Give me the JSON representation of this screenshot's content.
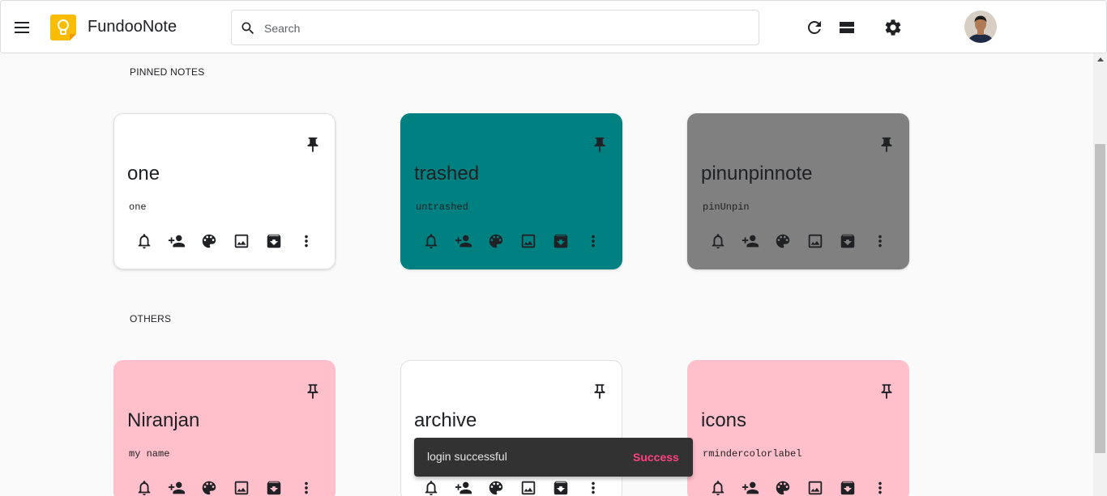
{
  "app": {
    "title": "FundooNote"
  },
  "search": {
    "placeholder": "Search"
  },
  "toolbar": {
    "refresh_icon": "refresh-icon",
    "view_icon": "list-view-icon",
    "settings_icon": "gear-icon"
  },
  "sections": {
    "pinned": "PINNED NOTES",
    "others": "OTHERS"
  },
  "colors": {
    "teal": "#008080",
    "gray": "#808080",
    "pink": "#ffc0cb",
    "white": "#ffffff",
    "accent": "#ff4081"
  },
  "notes": [
    {
      "title": "one",
      "body": "one",
      "color": "#ffffff"
    },
    {
      "title": "trashed",
      "body": "untrashed",
      "color": "#008080"
    },
    {
      "title": "pinunpinnote",
      "body": "pinUnpin",
      "color": "#808080"
    },
    {
      "title": "Niranjan",
      "body": "my name",
      "color": "#ffc0cb"
    },
    {
      "title": "archive",
      "body": "",
      "color": "#ffffff"
    },
    {
      "title": "icons",
      "body": "rmindercolorlabel",
      "color": "#ffc0cb"
    }
  ],
  "card_actions": [
    "bell-icon",
    "add-person-icon",
    "palette-icon",
    "image-icon",
    "archive-icon",
    "more-vert-icon"
  ],
  "snackbar": {
    "message": "login successful",
    "action": "Success"
  }
}
